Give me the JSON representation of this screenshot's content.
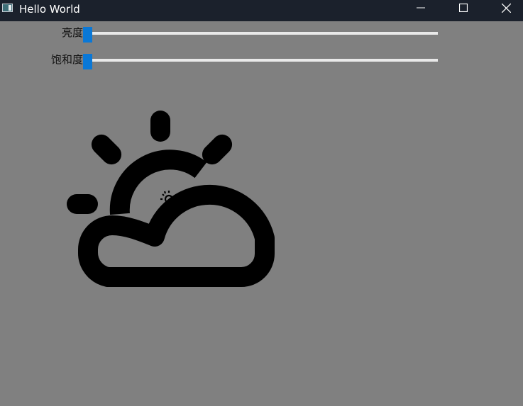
{
  "window": {
    "title": "Hello World",
    "app_icon": "app-window-icon",
    "controls": {
      "minimize_icon": "minimize-icon",
      "maximize_icon": "maximize-icon",
      "close_icon": "close-icon"
    }
  },
  "sliders": [
    {
      "label": "亮度",
      "value": 0
    },
    {
      "label": "饱和度",
      "value": 0
    }
  ],
  "image": {
    "icon": "partly-cloudy-icon"
  },
  "colors": {
    "background": "#808080",
    "titlebar": "#1b212c",
    "slider_thumb": "#0a78d7",
    "slider_track": "#e9e9e9",
    "icon": "#000000"
  }
}
